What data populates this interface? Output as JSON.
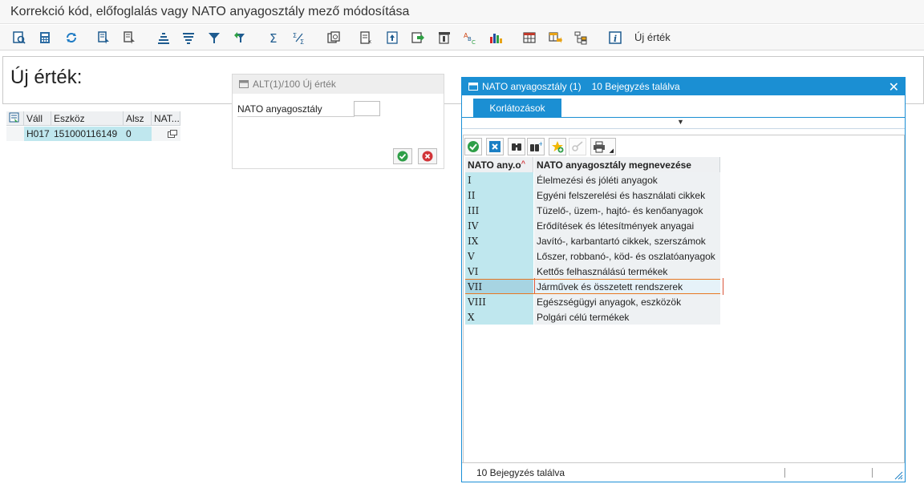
{
  "window": {
    "title": "Korrekció kód, előfoglalás vagy NATO anyagosztály mező módosítása"
  },
  "toolbar": {
    "text_button": "Új érték",
    "icons": [
      "details-icon",
      "calculator-icon",
      "refresh-icon",
      "select-icon",
      "deselect-icon",
      "sort-ascending-icon",
      "sort-descending-icon",
      "filter-icon",
      "filter-remove-icon",
      "sum-icon",
      "subtotal-icon",
      "print-preview-icon",
      "export-icon",
      "document-icon",
      "transfer-icon",
      "layout-icon",
      "abc-icon",
      "chart-icon",
      "grid-icon",
      "grid-export-icon",
      "hierarchy-icon",
      "info-icon"
    ]
  },
  "main": {
    "heading": "Új érték:"
  },
  "mini_table": {
    "headers": [
      "Váll",
      "Eszköz",
      "Alsz",
      "NAT..."
    ],
    "row": [
      "H017",
      "151000116149",
      "0",
      ""
    ]
  },
  "alt_dialog": {
    "title": "ALT(1)/100 Új érték",
    "field_label": "NATO anyagosztály",
    "field_value": ""
  },
  "nato_dialog": {
    "title": "NATO anyagosztály (1)",
    "title_count": "10 Bejegyzés találva",
    "close_label": "✕",
    "tab_label": "Korlátozások",
    "columns": [
      "NATO any.o",
      "NATO anyagosztály megnevezése"
    ],
    "rows": [
      {
        "code": "I",
        "name": "Élelmezési és jóléti anyagok"
      },
      {
        "code": "II",
        "name": "Egyéni felszerelési és használati cikkek"
      },
      {
        "code": "III",
        "name": "Tüzelő-, üzem-, hajtó- és kenőanyagok"
      },
      {
        "code": "IV",
        "name": "Erődítések és létesítmények anyagai"
      },
      {
        "code": "IX",
        "name": "Javító-, karbantartó cikkek, szerszámok"
      },
      {
        "code": "V",
        "name": "Lőszer, robbanó-, köd- és oszlatóanyagok"
      },
      {
        "code": "VI",
        "name": "Kettős felhasználású termékek"
      },
      {
        "code": "VII",
        "name": "Járművek és összetett rendszerek"
      },
      {
        "code": "VIII",
        "name": "Egészségügyi anyagok, eszközök"
      },
      {
        "code": "X",
        "name": "Polgári célú termékek"
      }
    ],
    "selected_row": "VII",
    "status_text": "10 Bejegyzés találva"
  }
}
